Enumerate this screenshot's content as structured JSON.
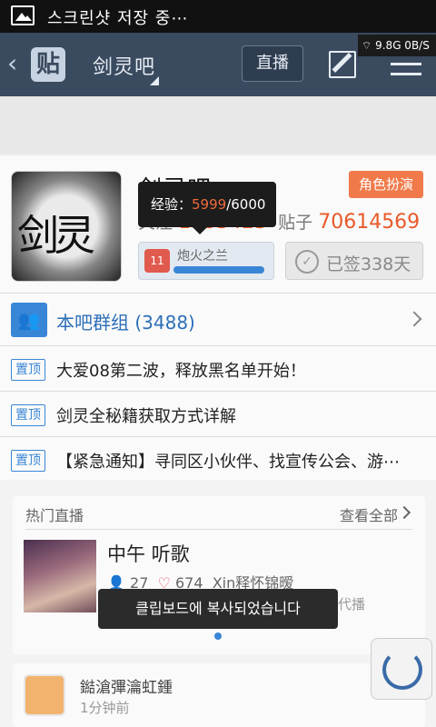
{
  "status_bar": {
    "toast": "스크린샷 저장 중⋯",
    "network": "9.8G 0B/S"
  },
  "toolbar": {
    "tie_label": "贴",
    "forum_title": "剑灵吧",
    "live_label": "直播"
  },
  "forum": {
    "avatar_text": "剑灵",
    "name": "剑灵吧",
    "role_badge": "角色扮演",
    "follow_label": "关注",
    "follow_count": "1333423",
    "posts_label": "贴子",
    "posts_count": "70614569",
    "level_name": "炮火之兰",
    "level_num": "11",
    "sign_label": "已签338天"
  },
  "tooltip": {
    "label": "经验：",
    "current": "5999",
    "total": "/6000"
  },
  "group_row": {
    "label": "本吧群组 (3488)"
  },
  "pinned": [
    {
      "tag": "置顶",
      "text": "大爱08第二波，释放黑名单开始！"
    },
    {
      "tag": "置顶",
      "text": "剑灵全秘籍获取方式详解"
    },
    {
      "tag": "置顶",
      "text": "【紧急通知】寻同区小伙伴、找宣传公会、游⋯"
    }
  ],
  "live": {
    "header": "热门直播",
    "more": "查看全部",
    "title": "中午 听歌",
    "viewers": "27",
    "likes": "674",
    "host": "Xin释怀锦暧",
    "sub": "代播"
  },
  "clipboard_toast": "클립보드에 복사되었습니다",
  "post": {
    "user": "鐑滄彃瀹虹鍾",
    "time": "1分钟前"
  }
}
